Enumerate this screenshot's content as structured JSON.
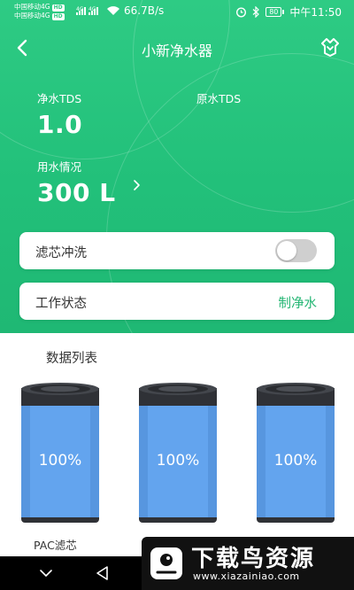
{
  "status_bar": {
    "carrier_1": "中国移动4G",
    "carrier_2": "中国移动4G",
    "hd": "HD",
    "net_type": "4G",
    "speed": "66.7B/s",
    "battery": "80",
    "time": "中午11:50"
  },
  "nav": {
    "title": "小新净水器"
  },
  "metrics": {
    "pure_tds_label": "净水TDS",
    "pure_tds_value": "1.0",
    "raw_tds_label": "原水TDS",
    "usage_label": "用水情况",
    "usage_value": "300 L"
  },
  "cards": {
    "flush_label": "滤芯冲洗",
    "flush_on": false,
    "status_label": "工作状态",
    "status_value": "制净水"
  },
  "data_list": {
    "title": "数据列表",
    "filters": [
      {
        "percent": "100%"
      },
      {
        "percent": "100%"
      },
      {
        "percent": "100%"
      }
    ],
    "first_filter_name": "PAC滤芯"
  },
  "watermark": {
    "title": "下载鸟资源",
    "url": "www.xiazainiao.com"
  },
  "colors": {
    "brand_green": "#22c07a",
    "filter_blue": "#63a4ee",
    "status_green": "#22b572"
  },
  "icons": {
    "back": "chevron-left-icon",
    "device": "device-icon",
    "usage_more": "chevron-right-icon"
  }
}
